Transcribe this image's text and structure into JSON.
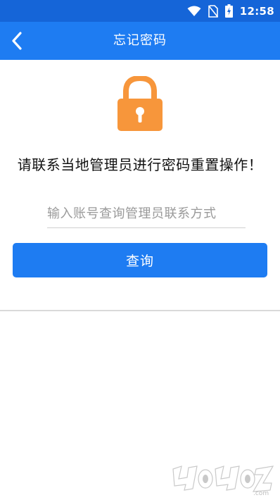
{
  "status_bar": {
    "time": "12:58",
    "icons": [
      "wifi-icon",
      "no-sim-icon",
      "battery-charging-icon"
    ]
  },
  "app_bar": {
    "title": "忘记密码",
    "back_icon": "chevron-left-icon"
  },
  "main": {
    "lock_icon": "padlock-icon",
    "lock_color": "#F7963B",
    "instruction": "请联系当地管理员进行密码重置操作！",
    "search_placeholder": "输入账号查询管理员联系方式",
    "query_label": "查询"
  },
  "watermark": {
    "text": "4o4oz.com"
  },
  "colors": {
    "status_bar": "#1565D8",
    "primary": "#1E7CF2"
  }
}
